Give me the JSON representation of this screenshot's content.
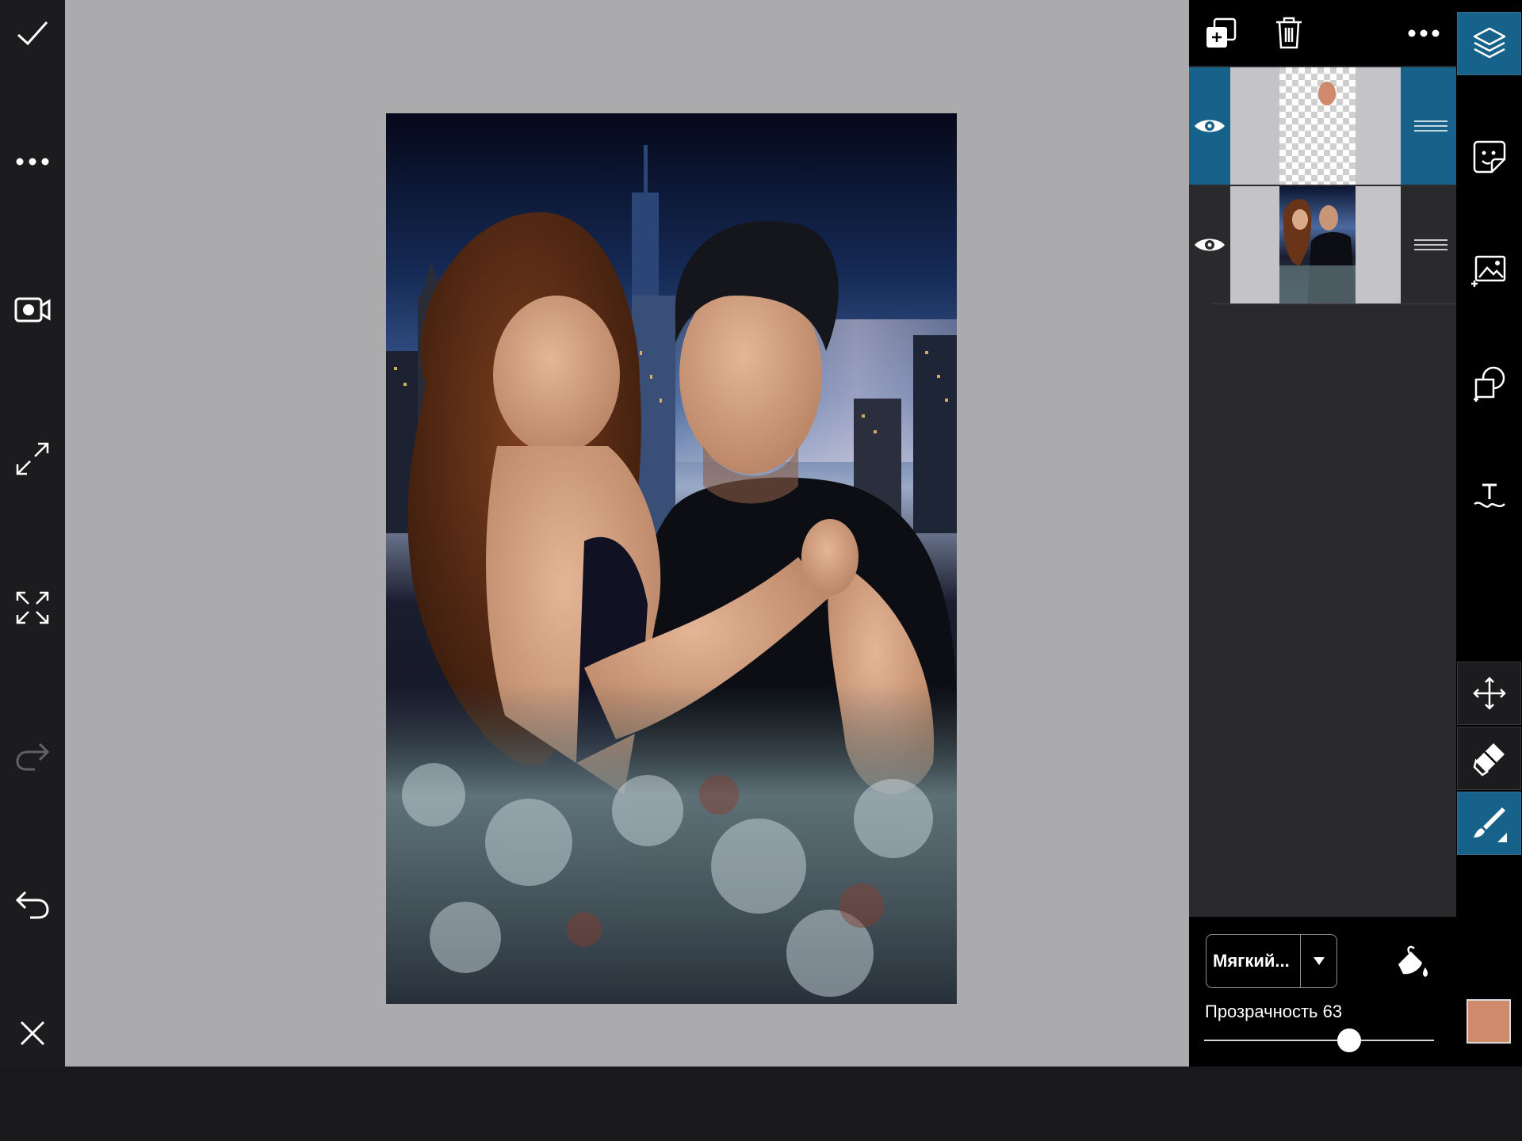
{
  "left_toolbar": {
    "tools": [
      "apply-icon",
      "more-icon",
      "record-video-icon",
      "expand-icon",
      "fit-screen-icon",
      "redo-icon",
      "undo-icon",
      "close-icon"
    ]
  },
  "canvas": {
    "background_color": "#abaaad"
  },
  "layers_panel": {
    "header_tools": [
      "duplicate-layer-icon",
      "delete-layer-icon",
      "more-icon"
    ],
    "layers": [
      {
        "name": "paint-layer",
        "visible": true,
        "selected": true
      },
      {
        "name": "photo-layer",
        "visible": true,
        "selected": false
      }
    ],
    "brush": {
      "type_label": "Мягкий...",
      "opacity_label": "Прозрачность 63",
      "opacity_value": 63,
      "color": "#cf8a6c"
    }
  },
  "right_toolbar": {
    "tools": [
      "layers-icon",
      "sticker-icon",
      "add-image-icon",
      "add-shape-icon",
      "text-icon",
      "move-icon",
      "eraser-icon",
      "brush-icon"
    ],
    "active_tool": "brush-icon"
  },
  "colors": {
    "accent": "#16628b",
    "panel_bg": "#2a2a2d",
    "toolbar_bg": "#1c1c1e"
  }
}
